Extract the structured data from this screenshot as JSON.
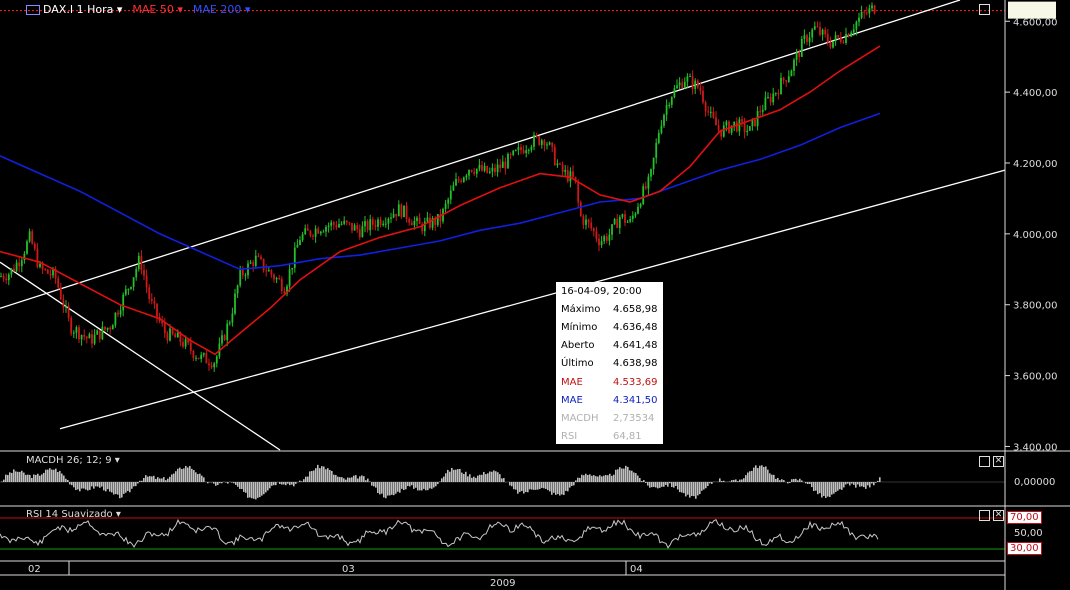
{
  "toolbar": {
    "symbol": "DAX.I 1 Hora",
    "mae50": "MAE 50",
    "mae200": "MAE 200"
  },
  "colors": {
    "up": "#22c22a",
    "down": "#d01818",
    "mae50": "#e01010",
    "mae200": "#1020e0",
    "channel": "#ffffff",
    "macd": "#c0c0c0"
  },
  "chart_data": {
    "type": "candlestick",
    "y_ticks": [
      "4.600,00",
      "4.400,00",
      "4.200,00",
      "4.000,00",
      "3.800,00",
      "3.600,00",
      "3.400,00"
    ],
    "y_values": [
      4600,
      4400,
      4200,
      4000,
      3800,
      3600,
      3400
    ],
    "ylim": [
      3390,
      4660
    ],
    "x_labels": [
      "02",
      "03",
      "04"
    ],
    "x_year": "2009",
    "close_path": [
      [
        0,
        3880
      ],
      [
        10,
        3890
      ],
      [
        20,
        3930
      ],
      [
        30,
        3990
      ],
      [
        40,
        3900
      ],
      [
        55,
        3880
      ],
      [
        70,
        3740
      ],
      [
        90,
        3700
      ],
      [
        110,
        3740
      ],
      [
        130,
        3860
      ],
      [
        140,
        3930
      ],
      [
        150,
        3810
      ],
      [
        165,
        3720
      ],
      [
        180,
        3700
      ],
      [
        200,
        3650
      ],
      [
        215,
        3640
      ],
      [
        230,
        3760
      ],
      [
        240,
        3880
      ],
      [
        255,
        3930
      ],
      [
        270,
        3890
      ],
      [
        285,
        3850
      ],
      [
        300,
        3990
      ],
      [
        320,
        4020
      ],
      [
        340,
        4030
      ],
      [
        360,
        4010
      ],
      [
        380,
        4040
      ],
      [
        400,
        4070
      ],
      [
        420,
        4020
      ],
      [
        440,
        4040
      ],
      [
        455,
        4140
      ],
      [
        470,
        4190
      ],
      [
        490,
        4170
      ],
      [
        510,
        4210
      ],
      [
        530,
        4260
      ],
      [
        545,
        4270
      ],
      [
        560,
        4180
      ],
      [
        575,
        4150
      ],
      [
        580,
        4050
      ],
      [
        590,
        4020
      ],
      [
        600,
        3980
      ],
      [
        610,
        4000
      ],
      [
        620,
        4050
      ],
      [
        630,
        4030
      ],
      [
        640,
        4100
      ],
      [
        650,
        4150
      ],
      [
        660,
        4310
      ],
      [
        670,
        4390
      ],
      [
        685,
        4440
      ],
      [
        700,
        4410
      ],
      [
        710,
        4330
      ],
      [
        720,
        4290
      ],
      [
        735,
        4310
      ],
      [
        750,
        4290
      ],
      [
        760,
        4350
      ],
      [
        775,
        4400
      ],
      [
        790,
        4460
      ],
      [
        805,
        4550
      ],
      [
        815,
        4580
      ],
      [
        830,
        4540
      ],
      [
        845,
        4560
      ],
      [
        860,
        4610
      ],
      [
        875,
        4640
      ]
    ],
    "mae50_path": [
      [
        0,
        3950
      ],
      [
        40,
        3920
      ],
      [
        80,
        3860
      ],
      [
        120,
        3800
      ],
      [
        160,
        3760
      ],
      [
        190,
        3700
      ],
      [
        215,
        3660
      ],
      [
        240,
        3720
      ],
      [
        270,
        3790
      ],
      [
        300,
        3870
      ],
      [
        340,
        3950
      ],
      [
        380,
        3990
      ],
      [
        420,
        4020
      ],
      [
        460,
        4080
      ],
      [
        500,
        4130
      ],
      [
        540,
        4170
      ],
      [
        570,
        4160
      ],
      [
        600,
        4110
      ],
      [
        630,
        4090
      ],
      [
        660,
        4120
      ],
      [
        690,
        4190
      ],
      [
        720,
        4290
      ],
      [
        750,
        4320
      ],
      [
        780,
        4350
      ],
      [
        810,
        4400
      ],
      [
        840,
        4460
      ],
      [
        880,
        4530
      ]
    ],
    "mae200_path": [
      [
        0,
        4220
      ],
      [
        40,
        4170
      ],
      [
        80,
        4120
      ],
      [
        120,
        4060
      ],
      [
        160,
        4000
      ],
      [
        200,
        3950
      ],
      [
        240,
        3900
      ],
      [
        280,
        3910
      ],
      [
        320,
        3930
      ],
      [
        360,
        3940
      ],
      [
        400,
        3960
      ],
      [
        440,
        3980
      ],
      [
        480,
        4010
      ],
      [
        520,
        4030
      ],
      [
        560,
        4060
      ],
      [
        600,
        4090
      ],
      [
        640,
        4100
      ],
      [
        680,
        4140
      ],
      [
        720,
        4180
      ],
      [
        760,
        4210
      ],
      [
        800,
        4250
      ],
      [
        840,
        4300
      ],
      [
        880,
        4340
      ]
    ],
    "channel_upper": [
      [
        0,
        3790
      ],
      [
        960,
        4660
      ]
    ],
    "channel_lower": [
      [
        60,
        3450
      ],
      [
        1005,
        4180
      ]
    ],
    "channel_down": [
      [
        0,
        3920
      ],
      [
        280,
        3390
      ]
    ],
    "last_price_line": 4630
  },
  "tooltip": {
    "date": "16-04-09, 20:00",
    "rows": [
      {
        "k": "Máximo",
        "v": "4.658,98",
        "color": "#000000"
      },
      {
        "k": "Mínimo",
        "v": "4.636,48",
        "color": "#000000"
      },
      {
        "k": "Aberto",
        "v": "4.641,48",
        "color": "#000000"
      },
      {
        "k": "Último",
        "v": "4.638,98",
        "color": "#000000"
      },
      {
        "k": "MAE",
        "v": "4.533,69",
        "color": "#c01010"
      },
      {
        "k": "MAE",
        "v": "4.341,50",
        "color": "#1020c0"
      },
      {
        "k": "MACDH",
        "v": "2,73534",
        "color": "#b0b0b0"
      },
      {
        "k": "RSI",
        "v": "64,81",
        "color": "#b0b0b0"
      }
    ]
  },
  "macd": {
    "label": "MACDH 26; 12; 9",
    "zero": "0,00000"
  },
  "rsi": {
    "label": "RSI 14 Suavizado",
    "upper": "70,00",
    "mid": "50,00",
    "lower": "30,00"
  }
}
